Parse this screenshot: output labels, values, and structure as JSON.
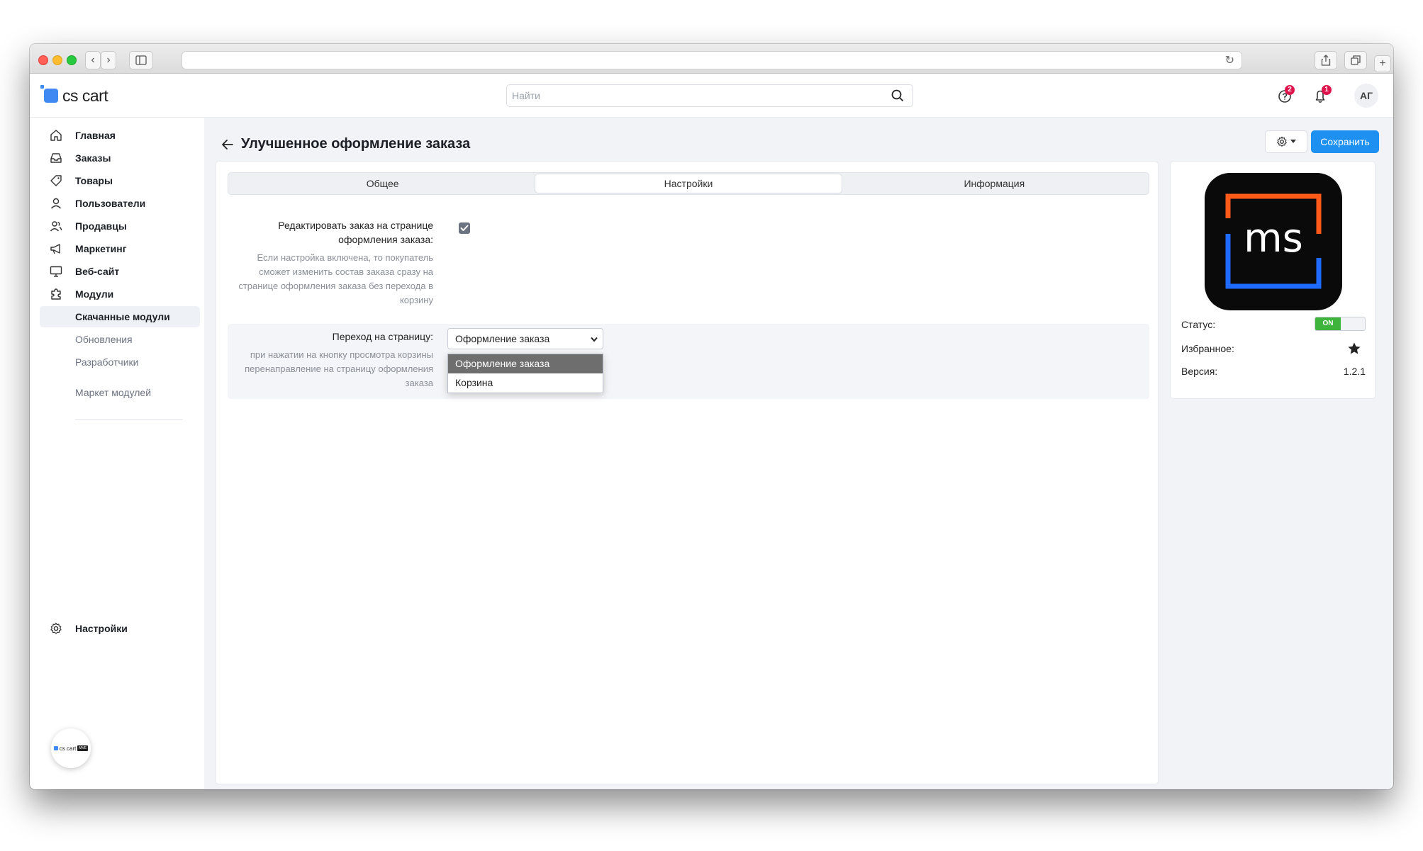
{
  "browser": {
    "reload_icon": "reload-icon"
  },
  "header": {
    "logo_text": "cs cart",
    "search_placeholder": "Найти",
    "help_badge": "2",
    "notifications_badge": "1",
    "avatar_initials": "АГ"
  },
  "sidebar": {
    "items": [
      {
        "label": "Главная",
        "icon": "home-icon"
      },
      {
        "label": "Заказы",
        "icon": "inbox-icon"
      },
      {
        "label": "Товары",
        "icon": "tag-icon"
      },
      {
        "label": "Пользователи",
        "icon": "user-icon"
      },
      {
        "label": "Продавцы",
        "icon": "users-icon"
      },
      {
        "label": "Маркетинг",
        "icon": "megaphone-icon"
      },
      {
        "label": "Веб-сайт",
        "icon": "monitor-icon"
      },
      {
        "label": "Модули",
        "icon": "puzzle-icon"
      }
    ],
    "subitems": [
      {
        "label": "Скачанные модули",
        "active": true
      },
      {
        "label": "Обновления",
        "active": false
      },
      {
        "label": "Разработчики",
        "active": false
      },
      {
        "label": "Маркет модулей",
        "active": false
      }
    ],
    "settings_label": "Настройки",
    "bottom_logo_text": "cs cart",
    "bottom_logo_tag": "MVE"
  },
  "page": {
    "title": "Улучшенное оформление заказа",
    "save_label": "Сохранить",
    "tabs": [
      "Общее",
      "Настройки",
      "Информация"
    ],
    "active_tab": 1
  },
  "settings": {
    "edit_order": {
      "label": "Редактировать заказ на странице оформления заказа:",
      "description": "Если настройка включена, то покупатель сможет изменить состав заказа сразу на странице оформления заказа без перехода в корзину",
      "checked": true
    },
    "redirect": {
      "label": "Переход на страницу:",
      "description": "при нажатии на кнопку просмотра корзины перенаправление на страницу оформления заказа",
      "value": "Оформление заказа",
      "options": [
        "Оформление заказа",
        "Корзина"
      ]
    }
  },
  "addon": {
    "logo_text": "ms",
    "status_label": "Статус:",
    "status_value": "ON",
    "favorite_label": "Избранное:",
    "version_label": "Версия:",
    "version_value": "1.2.1"
  },
  "colors": {
    "accent": "#1d90f2",
    "status_on": "#3fb43c",
    "logo_orange": "#ff5a1a",
    "logo_blue": "#1f6bff"
  }
}
